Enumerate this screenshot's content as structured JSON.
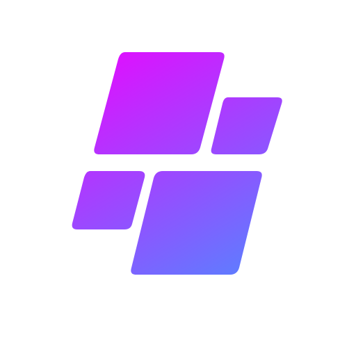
{
  "logo": {
    "name": "four-tile-logo",
    "colors": {
      "gradient_start": "#dd11ff",
      "gradient_end": "#5f7cff",
      "background": "#ffffff"
    }
  }
}
